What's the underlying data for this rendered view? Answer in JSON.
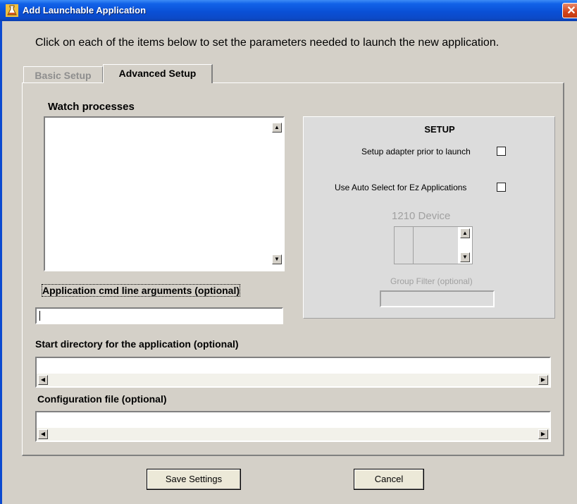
{
  "window": {
    "title": "Add Launchable Application",
    "close_glyph": "✕"
  },
  "instruction": "Click on each of the items below to set the parameters needed to launch the new application.",
  "tabs": [
    {
      "label": "Basic Setup",
      "active": false
    },
    {
      "label": "Advanced Setup",
      "active": true
    }
  ],
  "watch_processes": {
    "label": "Watch processes"
  },
  "setup": {
    "title": "SETUP",
    "adapter_label": "Setup adapter prior to launch",
    "adapter_checked": false,
    "autoselect_label": "Use Auto Select for Ez Applications",
    "autoselect_checked": false,
    "device_label": "1210 Device",
    "group_filter_label": "Group Filter (optional)",
    "group_filter_value": ""
  },
  "cmd_args": {
    "label": "Application cmd line arguments (optional)",
    "value": ""
  },
  "start_dir": {
    "label": "Start directory for the application (optional)",
    "value": ""
  },
  "config_file": {
    "label": "Configuration file (optional)",
    "value": ""
  },
  "buttons": {
    "save": "Save Settings",
    "cancel": "Cancel"
  },
  "icons": {
    "title_icon": "flask-icon",
    "scroll_up": "▲",
    "scroll_down": "▼",
    "scroll_left": "◀",
    "scroll_right": "▶"
  }
}
